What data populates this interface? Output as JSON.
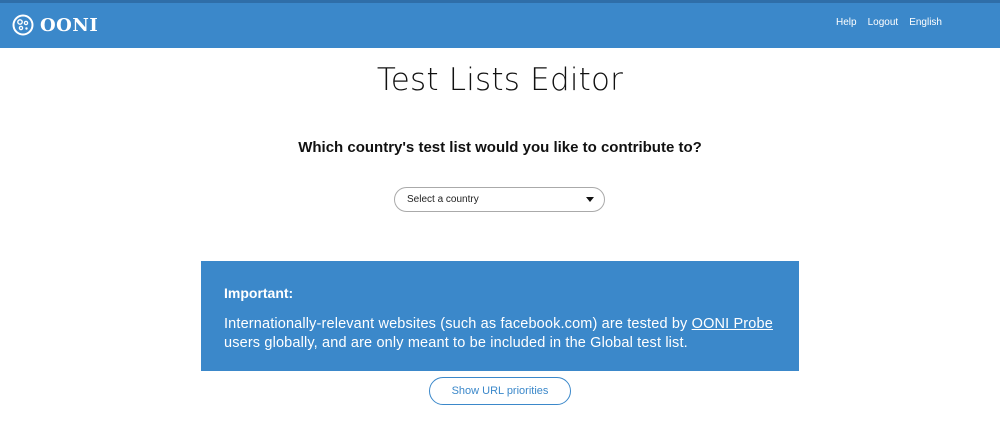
{
  "header": {
    "brand": "OONI",
    "nav": [
      "Help",
      "Logout",
      "English"
    ]
  },
  "main": {
    "title": "Test Lists Editor",
    "question": "Which country's test list would you like to contribute to?",
    "country_select": {
      "selected": "Select a country"
    },
    "important": {
      "heading": "Important:",
      "text_before": "Internationally-relevant websites (such as facebook.com) are tested by ",
      "link_text": "OONI Probe",
      "text_after": " users globally, and are only meant to be included in the Global test list."
    },
    "priorities_button": "Show URL priorities"
  },
  "colors": {
    "brand_blue": "#3b88ca"
  }
}
